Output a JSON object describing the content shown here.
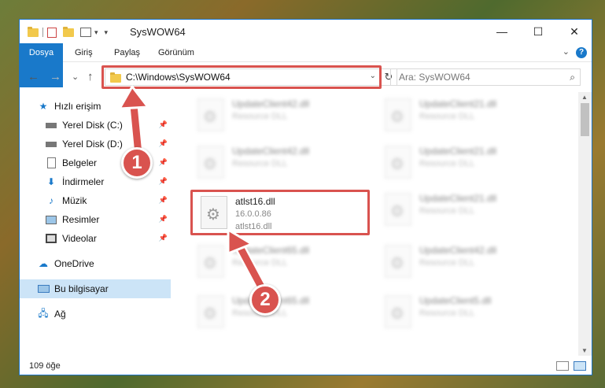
{
  "window": {
    "title": "SysWOW64",
    "min": "—",
    "max": "☐",
    "close": "✕"
  },
  "ribbon": {
    "tabs": [
      "Dosya",
      "Giriş",
      "Paylaş",
      "Görünüm"
    ],
    "help": "?"
  },
  "nav": {
    "back": "←",
    "forward": "→",
    "recent": "⌄",
    "up": "↑",
    "address": "C:\\Windows\\SysWOW64",
    "search_placeholder": "Ara: SysWOW64"
  },
  "sidebar": {
    "items": [
      {
        "label": "Hızlı erişim",
        "icon": "star-icon"
      },
      {
        "label": "Yerel Disk (C:)",
        "icon": "drive-icon"
      },
      {
        "label": "Yerel Disk (D:)",
        "icon": "drive-icon"
      },
      {
        "label": "Belgeler",
        "icon": "documents-icon"
      },
      {
        "label": "İndirmeler",
        "icon": "downloads-icon"
      },
      {
        "label": "Müzik",
        "icon": "music-icon"
      },
      {
        "label": "Resimler",
        "icon": "pictures-icon"
      },
      {
        "label": "Videolar",
        "icon": "videos-icon"
      },
      {
        "label": "OneDrive",
        "icon": "cloud-icon"
      },
      {
        "label": "Bu bilgisayar",
        "icon": "computer-icon"
      },
      {
        "label": "Ağ",
        "icon": "network-icon"
      }
    ]
  },
  "files": [
    {
      "name": "UpdateClient42.dll",
      "desc": "Resource DLL"
    },
    {
      "name": "UpdateClient21.dll",
      "desc": "Resource DLL"
    },
    {
      "name": "UpdateClient42.dll",
      "desc": "Resource DLL"
    },
    {
      "name": "UpdateClient21.dll",
      "desc": "Resource DLL"
    },
    {
      "name": "atlst16.dll",
      "version": "16.0.0.86",
      "desc": "atlst16.dll"
    },
    {
      "name": "UpdateClient21.dll",
      "desc": "Resource DLL"
    },
    {
      "name": "UpdateClient65.dll",
      "desc": "Resource DLL"
    },
    {
      "name": "UpdateClient42.dll",
      "desc": "Resource DLL"
    },
    {
      "name": "UpdateClient65.dll",
      "desc": "Resource DLL"
    },
    {
      "name": "UpdateClient5.dll",
      "desc": "Resource DLL"
    }
  ],
  "status": {
    "count": "109 öğe"
  },
  "callouts": {
    "one": "1",
    "two": "2"
  },
  "colors": {
    "accent": "#1979ca",
    "highlight": "#d9534f",
    "selected": "#cce4f7"
  }
}
